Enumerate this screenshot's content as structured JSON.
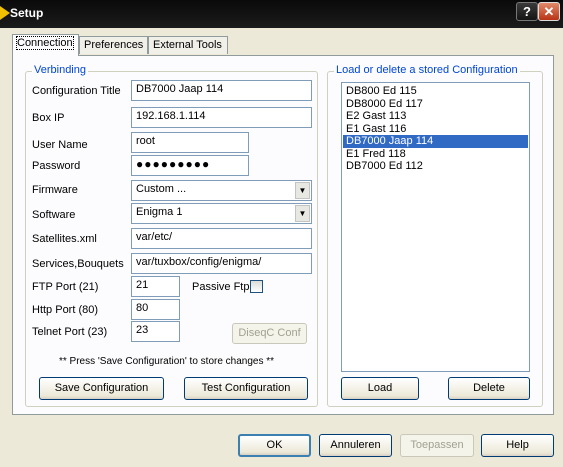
{
  "window": {
    "title": "Setup",
    "help_glyph": "?",
    "close_glyph": "✕"
  },
  "tabs": [
    {
      "label": "Connection",
      "active": true
    },
    {
      "label": "Preferences",
      "active": false
    },
    {
      "label": "External Tools",
      "active": false
    }
  ],
  "verbinding": {
    "legend": "Verbinding",
    "config_title_label": "Configuration Title",
    "config_title_value": "DB7000 Jaap 114",
    "box_ip_label": "Box IP",
    "box_ip_value": "192.168.1.114",
    "username_label": "User Name",
    "username_value": "root",
    "password_label": "Password",
    "password_value": "●●●●●●●●●",
    "firmware_label": "Firmware",
    "firmware_value": "Custom ...",
    "software_label": "Software",
    "software_value": "Enigma 1",
    "satellites_label": "Satellites.xml",
    "satellites_value": "var/etc/",
    "services_label": "Services,Bouquets",
    "services_value": "var/tuxbox/config/enigma/",
    "ftp_port_label": "FTP Port (21)",
    "ftp_port_value": "21",
    "passive_ftp_label": "Passive Ftp",
    "passive_ftp_checked": false,
    "http_port_label": "Http Port (80)",
    "http_port_value": "80",
    "telnet_port_label": "Telnet Port (23)",
    "telnet_port_value": "23",
    "diseqc_label": "DiseqC Conf",
    "note": "** Press 'Save Configuration' to store changes **",
    "save_label": "Save Configuration",
    "test_label": "Test Configuration"
  },
  "stored": {
    "legend": "Load or delete a stored Configuration",
    "items": [
      "DB800 Ed 115",
      "DB8000 Ed 117",
      "E2 Gast 113",
      "E1 Gast 116",
      "DB7000 Jaap 114",
      "E1 Fred 118",
      "DB7000 Ed 112"
    ],
    "selected_index": 4,
    "load_label": "Load",
    "delete_label": "Delete"
  },
  "footer": {
    "ok_label": "OK",
    "cancel_label": "Annuleren",
    "apply_label": "Toepassen",
    "help_label": "Help"
  },
  "colors": {
    "accent": "#316ac5",
    "legend": "#0046d5"
  },
  "icons": {
    "dropdown": "chevron-down-icon",
    "app": "app-icon"
  }
}
